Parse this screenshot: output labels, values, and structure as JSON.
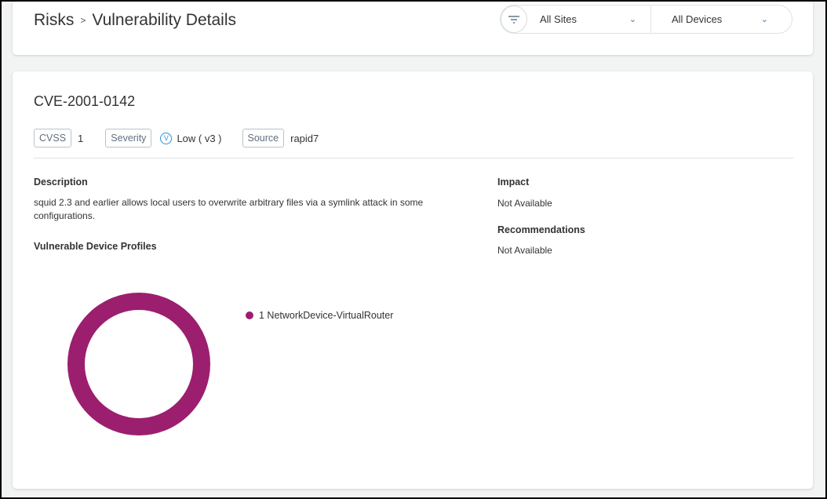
{
  "breadcrumb": {
    "parent": "Risks",
    "separator": ">",
    "current": "Vulnerability Details"
  },
  "filters": {
    "site": "All Sites",
    "device": "All Devices"
  },
  "cve": {
    "id": "CVE-2001-0142",
    "cvss_label": "CVSS",
    "cvss": "1",
    "severity_label": "Severity",
    "severity_icon": "V",
    "severity": "Low ( v3 )",
    "source_label": "Source",
    "source": "rapid7"
  },
  "description": {
    "label": "Description",
    "text": "squid 2.3 and earlier allows local users to overwrite arbitrary files via a symlink attack in some configurations."
  },
  "impact": {
    "label": "Impact",
    "text": "Not Available"
  },
  "recommendations": {
    "label": "Recommendations",
    "text": "Not Available"
  },
  "profiles": {
    "label": "Vulnerable Device Profiles"
  },
  "chart_data": {
    "type": "pie",
    "donut": true,
    "categories": [
      "NetworkDevice-VirtualRouter"
    ],
    "values": [
      1
    ],
    "colors": [
      "#9b1f6e"
    ],
    "legend": "right",
    "legend_labels": [
      "1 NetworkDevice-VirtualRouter"
    ]
  }
}
